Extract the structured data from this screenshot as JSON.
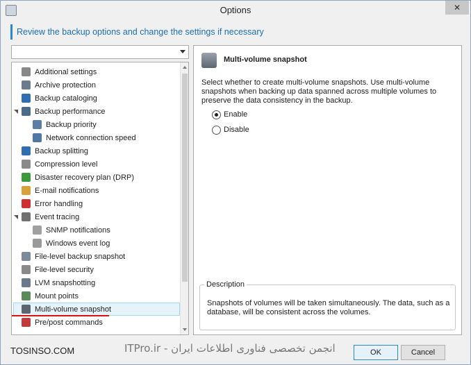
{
  "window": {
    "title": "Options",
    "close_glyph": "✕"
  },
  "header": {
    "text": "Review the backup options and change the settings if necessary"
  },
  "filter": {
    "value": ""
  },
  "tree": {
    "items": [
      {
        "label": "Additional settings",
        "icon": "gear-icon",
        "color": "#888888",
        "level": 0,
        "expander": false
      },
      {
        "label": "Archive protection",
        "icon": "archive-protection-icon",
        "color": "#6c7c8c",
        "level": 0,
        "expander": false
      },
      {
        "label": "Backup cataloging",
        "icon": "cataloging-icon",
        "color": "#2f6fb0",
        "level": 0,
        "expander": false
      },
      {
        "label": "Backup performance",
        "icon": "performance-icon",
        "color": "#4a6b8a",
        "level": 0,
        "expander": true
      },
      {
        "label": "Backup priority",
        "icon": "priority-icon",
        "color": "#5a7ea4",
        "level": 1,
        "expander": false
      },
      {
        "label": "Network connection speed",
        "icon": "network-icon",
        "color": "#4e79a7",
        "level": 1,
        "expander": false
      },
      {
        "label": "Backup splitting",
        "icon": "splitting-icon",
        "color": "#2f6fb0",
        "level": 0,
        "expander": false
      },
      {
        "label": "Compression level",
        "icon": "compression-icon",
        "color": "#8a8a8a",
        "level": 0,
        "expander": false
      },
      {
        "label": "Disaster recovery plan (DRP)",
        "icon": "drp-icon",
        "color": "#3a9a3a",
        "level": 0,
        "expander": false
      },
      {
        "label": "E-mail notifications",
        "icon": "email-icon",
        "color": "#d9a13a",
        "level": 0,
        "expander": false
      },
      {
        "label": "Error handling",
        "icon": "error-icon",
        "color": "#d12f2f",
        "level": 0,
        "expander": false
      },
      {
        "label": "Event tracing",
        "icon": "event-tracing-icon",
        "color": "#707070",
        "level": 0,
        "expander": true
      },
      {
        "label": "SNMP notifications",
        "icon": "snmp-icon",
        "color": "#a0a0a0",
        "level": 1,
        "expander": false
      },
      {
        "label": "Windows event log",
        "icon": "event-log-icon",
        "color": "#9a9a9a",
        "level": 1,
        "expander": false
      },
      {
        "label": "File-level backup snapshot",
        "icon": "file-snapshot-icon",
        "color": "#7a8a9a",
        "level": 0,
        "expander": false
      },
      {
        "label": "File-level security",
        "icon": "file-security-icon",
        "color": "#8a8a8a",
        "level": 0,
        "expander": false
      },
      {
        "label": "LVM snapshotting",
        "icon": "lvm-icon",
        "color": "#6a7a8a",
        "level": 0,
        "expander": false
      },
      {
        "label": "Mount points",
        "icon": "mount-points-icon",
        "color": "#5a8a5a",
        "level": 0,
        "expander": false
      },
      {
        "label": "Multi-volume snapshot",
        "icon": "multi-volume-icon",
        "color": "#5d6670",
        "level": 0,
        "expander": false,
        "selected": true
      },
      {
        "label": "Pre/post commands",
        "icon": "commands-icon",
        "color": "#c03a3a",
        "level": 0,
        "expander": false
      }
    ]
  },
  "panel": {
    "title": "Multi-volume snapshot",
    "description": "Select whether to create multi-volume snapshots. Use multi-volume snapshots when backing up data spanned across multiple volumes to preserve the data consistency in the backup.",
    "options": [
      {
        "label": "Enable",
        "checked": true
      },
      {
        "label": "Disable",
        "checked": false
      }
    ],
    "description_group": {
      "legend": "Description",
      "text": "Snapshots of volumes will be taken simultaneously. The data, such as a database, will be consistent across the volumes."
    }
  },
  "footer": {
    "left_text": "TOSINSO.COM",
    "watermark": "ITPro.ir - انجمن تخصصی فناوری اطلاعات ایران",
    "ok_label": "OK",
    "cancel_label": "Cancel"
  }
}
